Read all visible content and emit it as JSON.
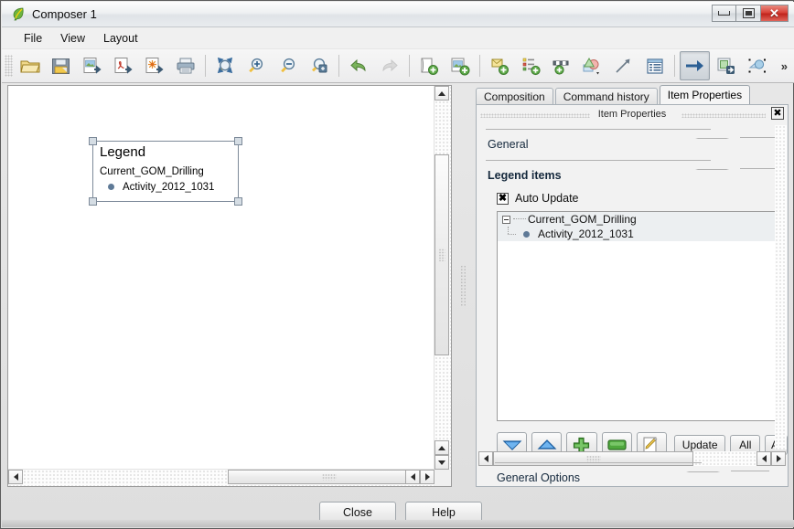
{
  "window": {
    "title": "Composer 1",
    "icon": "qgis-leaf-icon",
    "controls": {
      "minimize": "minimize",
      "maximize": "restore",
      "close": "close"
    }
  },
  "menubar": {
    "items": [
      "File",
      "View",
      "Layout"
    ]
  },
  "toolbar": {
    "items": [
      {
        "name": "open-template-icon",
        "label": "Open Template"
      },
      {
        "name": "save-template-icon",
        "label": "Save Template As"
      },
      {
        "name": "export-image-icon",
        "label": "Export as Image"
      },
      {
        "name": "export-pdf-icon",
        "label": "Export as PDF"
      },
      {
        "name": "export-svg-icon",
        "label": "Export as SVG"
      },
      {
        "name": "print-icon",
        "label": "Print"
      },
      {
        "name": "zoom-full-icon",
        "label": "Zoom Full"
      },
      {
        "name": "zoom-in-icon",
        "label": "Zoom In"
      },
      {
        "name": "zoom-out-icon",
        "label": "Zoom Out"
      },
      {
        "name": "zoom-actual-icon",
        "label": "Zoom to 100%"
      },
      {
        "name": "undo-icon",
        "label": "Undo"
      },
      {
        "name": "redo-icon",
        "label": "Redo"
      },
      {
        "name": "add-page-icon",
        "label": "Add Page"
      },
      {
        "name": "add-image-icon",
        "label": "Add Image"
      },
      {
        "name": "add-label-icon",
        "label": "Add Label"
      },
      {
        "name": "add-legend-icon",
        "label": "Add Legend"
      },
      {
        "name": "add-scalebar-icon",
        "label": "Add Scalebar"
      },
      {
        "name": "add-shape-icon",
        "label": "Add Shape"
      },
      {
        "name": "add-arrow-icon",
        "label": "Add Arrow"
      },
      {
        "name": "add-table-icon",
        "label": "Add Attribute Table"
      },
      {
        "name": "select-move-item-icon",
        "label": "Select / Move item"
      },
      {
        "name": "move-item-content-icon",
        "label": "Move item content"
      },
      {
        "name": "group-items-icon",
        "label": "Group Items"
      }
    ],
    "overflow_label": "»"
  },
  "canvas": {
    "legend_item": {
      "title": "Legend",
      "group": "Current_GOM_Drilling",
      "entry": "Activity_2012_1031",
      "symbol_color": "#5f7a97",
      "selected": true
    }
  },
  "panel": {
    "tabs": [
      {
        "label": "Composition",
        "selected": false
      },
      {
        "label": "Command history",
        "selected": false
      },
      {
        "label": "Item Properties",
        "selected": true
      }
    ],
    "dock_title": "Item Properties",
    "close_glyph": "✖",
    "groups": [
      {
        "title": "General",
        "bold": false
      },
      {
        "title": "Legend items",
        "bold": true
      }
    ],
    "auto_update": {
      "label": "Auto Update",
      "checked": true,
      "mark": "✖"
    },
    "tree": {
      "root": {
        "label": "Current_GOM_Drilling",
        "expanded": true
      },
      "children": [
        {
          "label": "Activity_2012_1031",
          "symbol_color": "#5f7a97"
        }
      ]
    },
    "item_buttons": [
      {
        "name": "move-down-button",
        "icon": "down-arrow-icon"
      },
      {
        "name": "move-up-button",
        "icon": "up-arrow-icon"
      },
      {
        "name": "add-item-button",
        "icon": "plus-icon"
      },
      {
        "name": "remove-item-button",
        "icon": "minus-icon"
      },
      {
        "name": "edit-item-button",
        "icon": "pencil-edit-icon"
      }
    ],
    "text_buttons": [
      {
        "name": "update-button",
        "label": "Update"
      },
      {
        "name": "all-button",
        "label": "All"
      },
      {
        "name": "add-group-button",
        "label": "Ad"
      }
    ],
    "general_options": {
      "title": "General Options",
      "bold": false
    }
  },
  "footer": {
    "close_label": "Close",
    "help_label": "Help"
  },
  "colors": {
    "accent": "#5f7a97",
    "close_red": "#c0241c",
    "panel_bg": "#f2f2f2",
    "green": "#3f9a33",
    "blue": "#2b74c8"
  }
}
